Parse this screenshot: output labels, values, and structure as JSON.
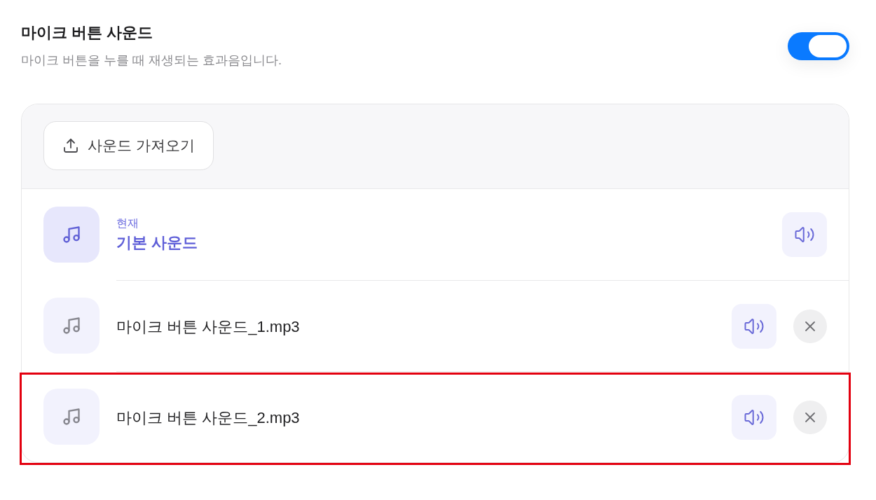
{
  "setting": {
    "title": "마이크 버튼 사운드",
    "description": "마이크 버튼을 누를 때 재생되는 효과음입니다.",
    "on": true
  },
  "import_button": {
    "label": "사운드 가져오기"
  },
  "sounds": [
    {
      "caption": "현재",
      "name": "기본 사운드",
      "selected": true,
      "removable": false,
      "highlighted": false
    },
    {
      "name": "마이크 버튼 사운드_1.mp3",
      "selected": false,
      "removable": true,
      "highlighted": false
    },
    {
      "name": "마이크 버튼 사운드_2.mp3",
      "selected": false,
      "removable": true,
      "highlighted": true
    }
  ]
}
